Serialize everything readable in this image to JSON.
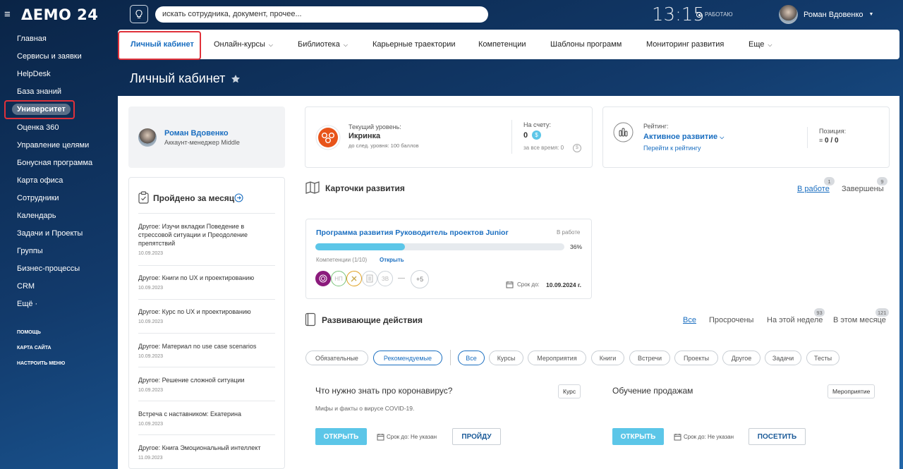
{
  "topbar": {
    "logo": "ΔEMO 24",
    "search_placeholder": "искать сотрудника, документ, прочее...",
    "time": "13:15",
    "status": "РАБОТАЮ",
    "user_name": "Роман Вдовенко"
  },
  "sidebar": {
    "items": [
      "Главная",
      "Сервисы и заявки",
      "HelpDesk",
      "База знаний",
      "Университет",
      "Оценка 360",
      "Управление целями",
      "Бонусная программа",
      "Карта офиса",
      "Сотрудники",
      "Календарь",
      "Задачи и Проекты",
      "Группы",
      "Бизнес-процессы",
      "CRM",
      "Ещё ·"
    ],
    "small_links": [
      "ПОМОЩЬ",
      "КАРТА САЙТА",
      "НАСТРОИТЬ МЕНЮ"
    ]
  },
  "nav": {
    "items": [
      "Личный кабинет",
      "Онлайн-курсы",
      "Библиотека",
      "Карьерные траектории",
      "Компетенции",
      "Шаблоны программ",
      "Мониторинг развития",
      "Еще"
    ]
  },
  "page_title": "Личный кабинет",
  "profile": {
    "name": "Роман Вдовенко",
    "role": "Аккаунт-менеджер Middle"
  },
  "level": {
    "label": "Текущий уровень:",
    "value": "Икринка",
    "next": "до след. уровня: 100 баллов",
    "account_label": "На счету:",
    "account_value": "0",
    "total_label": "за все время: 0"
  },
  "rating": {
    "label": "Рейтинг:",
    "value": "Активное развитие",
    "link": "Перейти к рейтингу",
    "position_label": "Позиция:",
    "position_value": "0 / 0"
  },
  "monthly": {
    "title": "Пройдено за месяц",
    "items": [
      {
        "text": "Другое: Изучи вкладки Поведение в стрессовой ситуации и Преодоление препятствий",
        "date": "10.09.2023"
      },
      {
        "text": "Другое: Книги по UX и проектированию",
        "date": "10.09.2023"
      },
      {
        "text": "Другое: Курс по UX и проектированию",
        "date": "10.09.2023"
      },
      {
        "text": "Другое: Материал no use case scenarios",
        "date": "10.09.2023"
      },
      {
        "text": "Другое: Решение сложной ситуации",
        "date": "10.09.2023"
      },
      {
        "text": "Встреча с наставником: Екатерина",
        "date": "10.09.2023"
      },
      {
        "text": "Другое: Книга Эмоциональный интеллект",
        "date": "11.09.2023"
      }
    ]
  },
  "dev_cards": {
    "title": "Карточки развития",
    "tab_in_work": "В работе",
    "tab_in_work_count": "1",
    "tab_done": "Завершены",
    "tab_done_count": "9",
    "program": {
      "title": "Программа развития Руководитель проектов Junior",
      "status": "В работе",
      "progress": 36,
      "progress_label": "36%",
      "competencies": "Компетенции (1/10)",
      "open": "Открыть",
      "avatars": [
        "НП",
        "ЗВ"
      ],
      "more": "+5",
      "deadline_label": "Срок до:",
      "deadline": "10.09.2024 г."
    }
  },
  "actions": {
    "title": "Развивающие действия",
    "tabs": [
      {
        "label": "Все",
        "count": ""
      },
      {
        "label": "Просрочены",
        "count": ""
      },
      {
        "label": "На этой неделе",
        "count": "93"
      },
      {
        "label": "В этом месяце",
        "count": "121"
      }
    ],
    "filters_left": [
      "Обязательные",
      "Рекомендуемые"
    ],
    "filters_right": [
      "Все",
      "Курсы",
      "Мероприятия",
      "Книги",
      "Встречи",
      "Проекты",
      "Другое",
      "Задачи",
      "Тесты"
    ],
    "cards": [
      {
        "title": "Что нужно знать про коронавирус?",
        "tag": "Курс",
        "desc": "Мифы и факты о вирусе COVID-19.",
        "open": "ОТКРЫТЬ",
        "deadline": "Срок до: Не указан",
        "action": "ПРОЙДУ"
      },
      {
        "title": "Обучение продажам",
        "tag": "Мероприятие",
        "desc": "",
        "open": "ОТКРЫТЬ",
        "deadline": "Срок до: Не указан",
        "action": "ПОСЕТИТЬ"
      }
    ]
  },
  "colors": {
    "accent": "#1a6ec0",
    "button": "#5cc6e8",
    "highlight": "#e0313a",
    "level_icon": "#e8541a"
  }
}
